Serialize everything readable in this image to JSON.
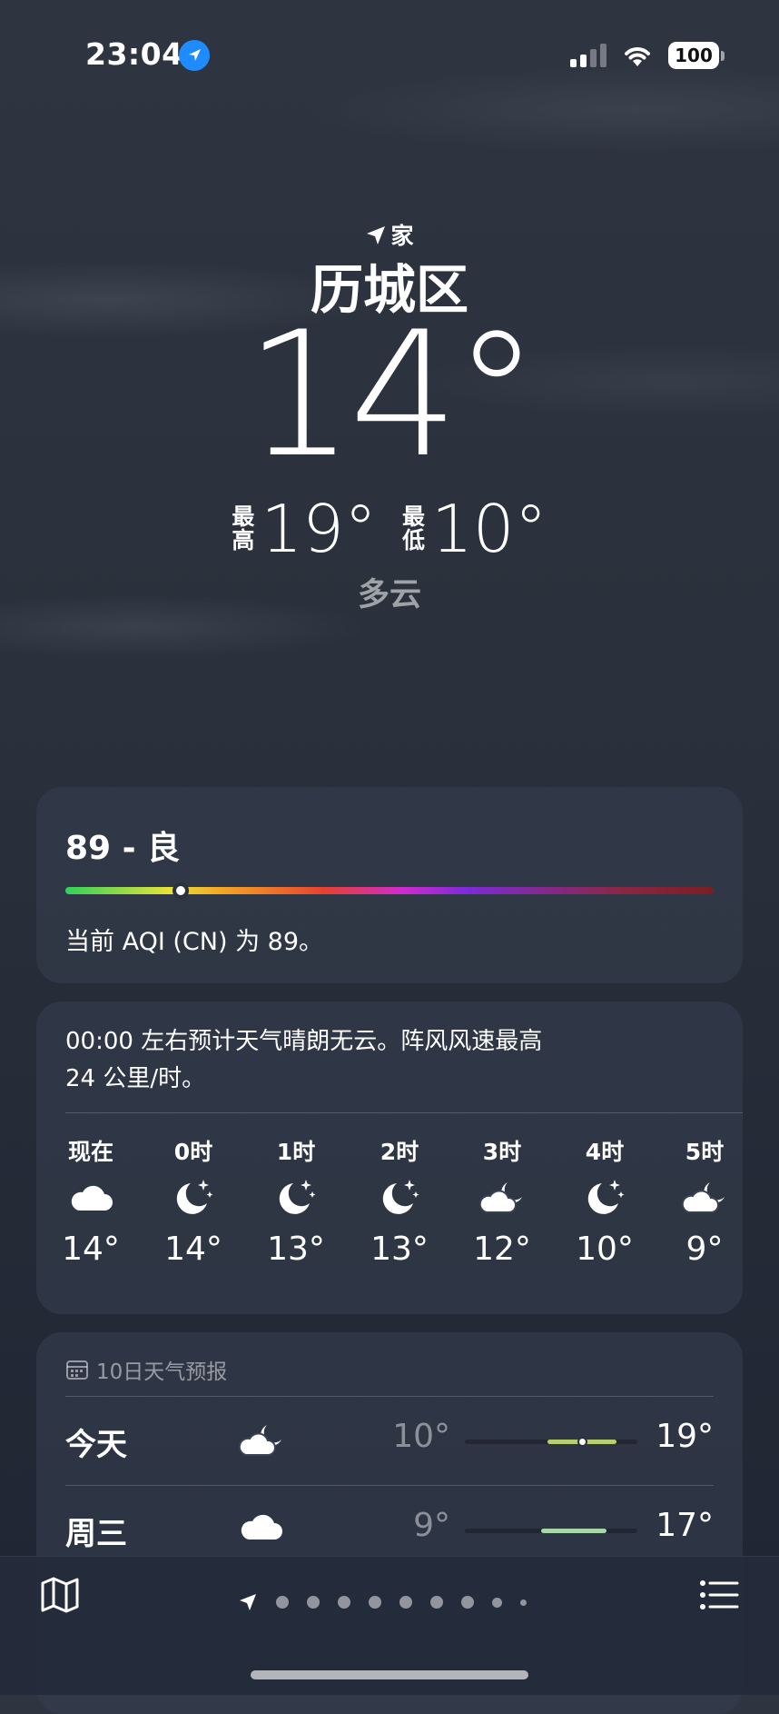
{
  "status": {
    "time": "23:04",
    "battery": "100"
  },
  "header": {
    "location_label": "家",
    "city": "历城区",
    "temperature": "14°",
    "high_label": "最高",
    "high": "19°",
    "low_label": "最低",
    "low": "10°",
    "condition": "多云"
  },
  "aqi": {
    "title": "89 - 良",
    "description": "当前 AQI (CN) 为 89。",
    "value": 89
  },
  "hourly": {
    "summary_line1": "00:00 左右预计天气晴朗无云。阵风风速最高",
    "summary_line2": "24 公里/时。",
    "hours": [
      {
        "label": "现在",
        "icon": "cloud-icon",
        "temp": "14°"
      },
      {
        "label": "0时",
        "icon": "moon-stars-icon",
        "temp": "14°"
      },
      {
        "label": "1时",
        "icon": "moon-stars-icon",
        "temp": "13°"
      },
      {
        "label": "2时",
        "icon": "moon-stars-icon",
        "temp": "13°"
      },
      {
        "label": "3时",
        "icon": "cloud-moon-icon",
        "temp": "12°"
      },
      {
        "label": "4时",
        "icon": "moon-stars-icon",
        "temp": "10°"
      },
      {
        "label": "5时",
        "icon": "cloud-moon-icon",
        "temp": "9°"
      }
    ]
  },
  "forecast": {
    "title": "10日天气预报",
    "days": [
      {
        "day": "今天",
        "icon": "cloud-moon-icon",
        "low": "10°",
        "high": "19°",
        "range_start": 0.48,
        "range_end": 0.88,
        "current": 0.68,
        "color": "#b7cf6e"
      },
      {
        "day": "周三",
        "icon": "cloud-icon",
        "low": "9°",
        "high": "17°",
        "range_start": 0.44,
        "range_end": 0.82,
        "color": "#a8d6a8"
      }
    ]
  },
  "colors": {
    "location_blue": "#1e8cff"
  }
}
